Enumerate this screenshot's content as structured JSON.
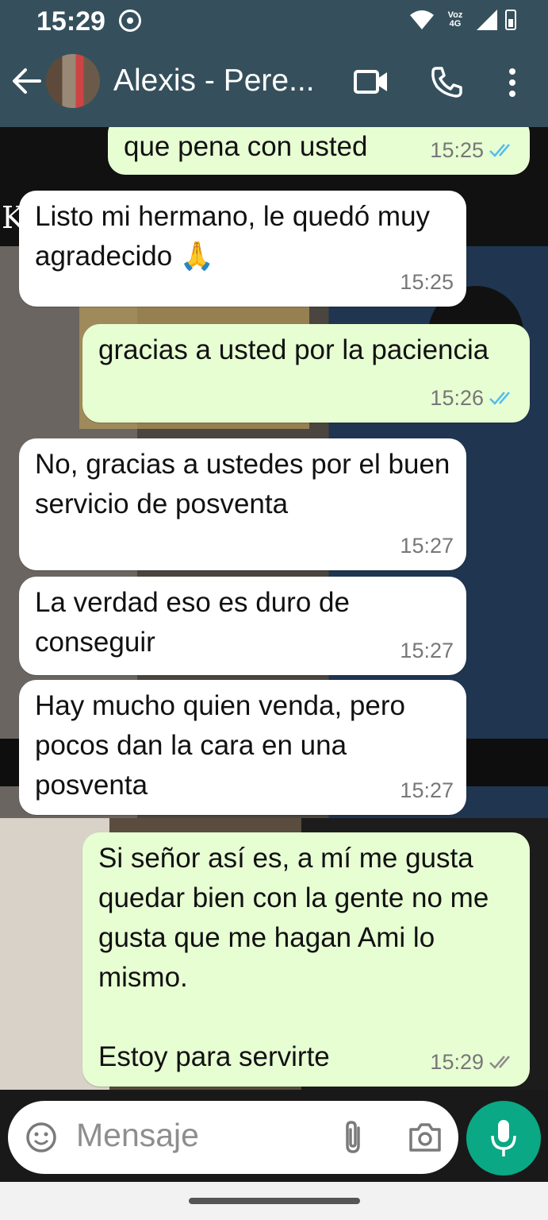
{
  "status_bar": {
    "time": "15:29",
    "network": "Voz 4G"
  },
  "header": {
    "contact_name": "Alexis - Pere..."
  },
  "messages": [
    {
      "direction": "out",
      "text": "que pena con usted",
      "time": "15:25",
      "read": true
    },
    {
      "direction": "in",
      "text": "Listo mi hermano, le quedó muy agradecido 🙏",
      "time": "15:25"
    },
    {
      "direction": "out",
      "text": "gracias a usted por la paciencia",
      "time": "15:26",
      "read": true
    },
    {
      "direction": "in",
      "text": "No, gracias a ustedes por el buen servicio de posventa",
      "time": "15:27"
    },
    {
      "direction": "in",
      "text": "La verdad eso es duro de conseguir",
      "time": "15:27"
    },
    {
      "direction": "in",
      "text": "Hay mucho quien venda, pero pocos dan la cara en una posventa",
      "time": "15:27"
    },
    {
      "direction": "out",
      "text": "Si señor así es, a mí me gusta quedar bien con la gente no me gusta que me hagan Ami lo mismo.\n\nEstoy para servirte",
      "time": "15:29",
      "read": false
    }
  ],
  "wallpaper": {
    "letter": "K"
  },
  "composer": {
    "placeholder": "Mensaje"
  },
  "colors": {
    "header": "#35505c",
    "outgoing": "#e7fed3",
    "incoming": "#ffffff",
    "accent": "#0aa884",
    "read_tick": "#53bdeb",
    "unread_tick": "#8c8c8c"
  }
}
